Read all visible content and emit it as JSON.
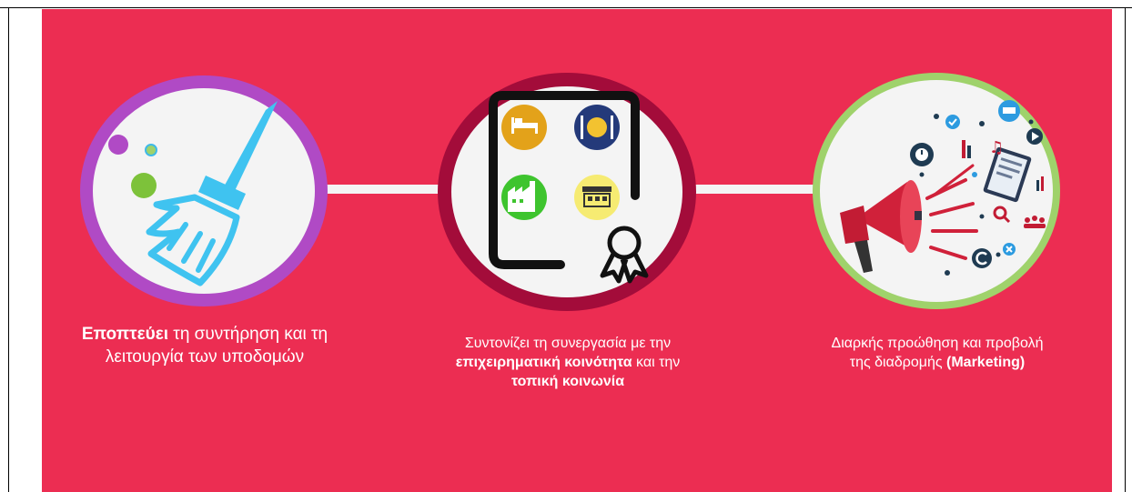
{
  "items": [
    {
      "caption_bold": "Εποπτεύει",
      "caption_rest": " τη συντήρηση και τη λειτουργία των υποδομών",
      "icon": "broom-icon"
    },
    {
      "caption_plain": "Συντονίζει τη συνεργασία με την ",
      "caption_bold_1": "επιχειρηματική κοινότητα",
      "caption_mid": " και την ",
      "caption_bold_2": "τοπική κοινωνία",
      "icon": "certificate-icon"
    },
    {
      "caption_plain": "Διαρκής προώθηση και προβολή της διαδρομής ",
      "caption_bold": "(Marketing)",
      "icon": "megaphone-icon"
    }
  ],
  "colors": {
    "background": "#ec2d52",
    "circle_fill": "#f4f4f4",
    "ring_1": "#b04ac5",
    "ring_2": "#a30c3a",
    "ring_3": "#9fd26b"
  }
}
